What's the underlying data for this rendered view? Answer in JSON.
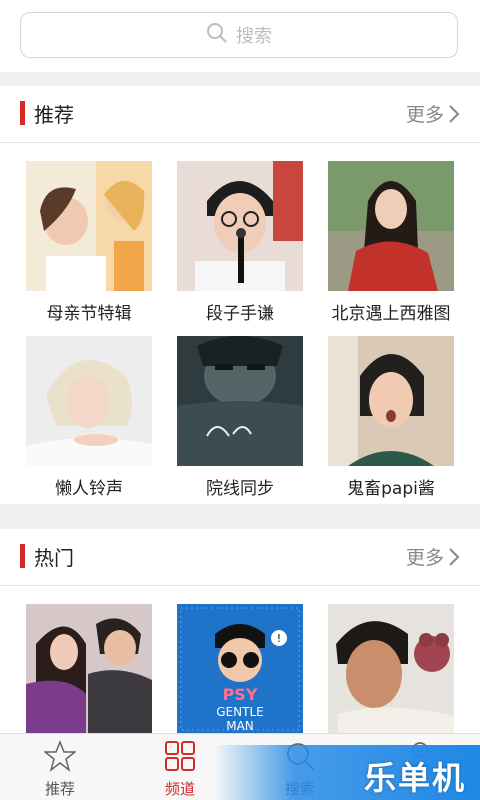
{
  "search": {
    "placeholder": "搜索"
  },
  "recommend": {
    "title": "推荐",
    "more": "更多",
    "items": [
      {
        "caption": "母亲节特辑"
      },
      {
        "caption": "段子手谦"
      },
      {
        "caption": "北京遇上西雅图"
      },
      {
        "caption": "懒人铃声"
      },
      {
        "caption": "院线同步"
      },
      {
        "caption": "鬼畜papi酱"
      }
    ]
  },
  "hot": {
    "title": "热门",
    "more": "更多",
    "items": [
      {
        "caption": ""
      },
      {
        "caption": ""
      },
      {
        "caption": ""
      }
    ],
    "psy_art_text": [
      "PSY",
      "GENTLE",
      "MAN"
    ]
  },
  "tabs": [
    {
      "label": "推荐",
      "icon": "star-icon",
      "active": false
    },
    {
      "label": "频道",
      "icon": "grid-icon",
      "active": true
    },
    {
      "label": "搜索",
      "icon": "search-icon",
      "active": false
    },
    {
      "label": "",
      "icon": "user-icon",
      "active": false
    }
  ],
  "watermark": "乐单机",
  "colors": {
    "accent": "#d42a2a",
    "watermark_blue": "#1e88e5"
  }
}
